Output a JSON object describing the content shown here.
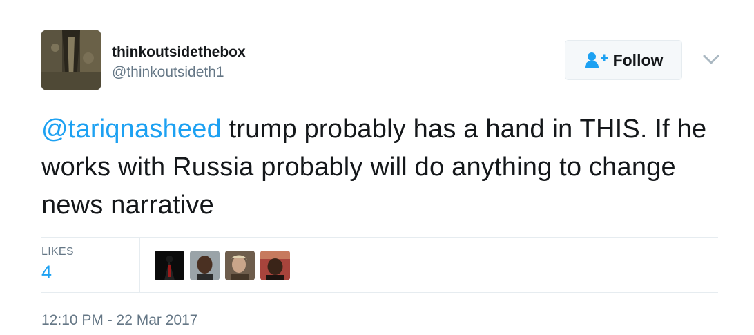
{
  "user": {
    "display_name": "thinkoutsidethebox",
    "screen_name": "@thinkoutsideth1"
  },
  "follow_button": {
    "label": "Follow",
    "icon": "follow-person-plus-icon"
  },
  "menu": {
    "icon": "chevron-down-icon"
  },
  "tweet": {
    "mention": "@tariqnasheed",
    "text": " trump probably has a hand in THIS. If he works with Russia probably will do anything to change news narrative"
  },
  "stats": {
    "likes_label": "LIKES",
    "likes_count": "4"
  },
  "timestamp": "12:10 PM - 22 Mar 2017",
  "colors": {
    "accent": "#1da1f2",
    "secondary_text": "#657786",
    "primary_text": "#14171a",
    "border": "#e6ecf0"
  }
}
